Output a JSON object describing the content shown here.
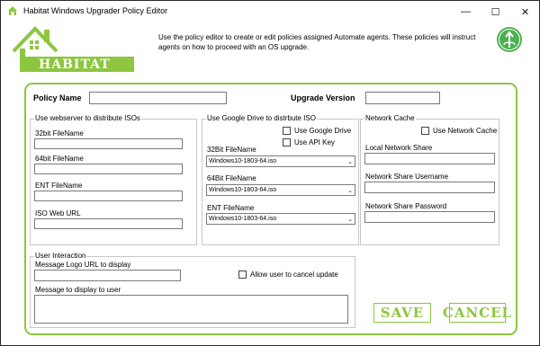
{
  "window": {
    "title": "Habitat Windows Upgrader Policy Editor",
    "minimize_glyph": "—",
    "maximize_glyph": "☐",
    "close_glyph": "✕"
  },
  "header": {
    "logo_text": "Habitat",
    "description": "Use the policy editor to create or edit policies assigned Automate agents. These policies will instruct agents on how to proceed with an OS upgrade.",
    "brand_color": "#8dc63f"
  },
  "form": {
    "policy_name_label": "Policy Name",
    "policy_name_value": "",
    "upgrade_version_label": "Upgrade Version",
    "upgrade_version_value": ""
  },
  "webserver": {
    "title": "Use webserver to distribute ISOs",
    "file32_label": "32bit FileName",
    "file32_value": "",
    "file64_label": "64bit FileName",
    "file64_value": "",
    "ent_label": "ENT FileName",
    "ent_value": "",
    "weburl_label": "ISO Web URL",
    "weburl_value": ""
  },
  "gdrive": {
    "title": "Use Google Drive to distrbute ISO",
    "use_gdrive_label": "Use Google Drive",
    "use_api_key_label": "Use API Key",
    "file32_label": "32Bit FileName",
    "file32_selected": "Windows10-1803-64.iso",
    "file64_label": "64Bit FileName",
    "file64_selected": "Windows10-1803-64.iso",
    "ent_label": "ENT FileName",
    "ent_selected": "Windows10-1803-64.iso"
  },
  "netcache": {
    "title": "Network Cache",
    "use_cache_label": "Use Network Cache",
    "share_label": "Local Network Share",
    "share_value": "",
    "user_label": "Network Share Username",
    "user_value": "",
    "pass_label": "Network Share Password",
    "pass_value": ""
  },
  "interaction": {
    "title": "User Interaction",
    "logo_url_label": "Message Logo URL to display",
    "logo_url_value": "",
    "allow_cancel_label": "Allow user to cancel update",
    "message_label": "Message to display to user"
  },
  "actions": {
    "save_label": "Save",
    "cancel_label": "Cancel"
  },
  "icons": {
    "app": "habitat-house-icon",
    "globe": "upgrade-globe-icon",
    "dropdown": "chevron-down-icon"
  }
}
